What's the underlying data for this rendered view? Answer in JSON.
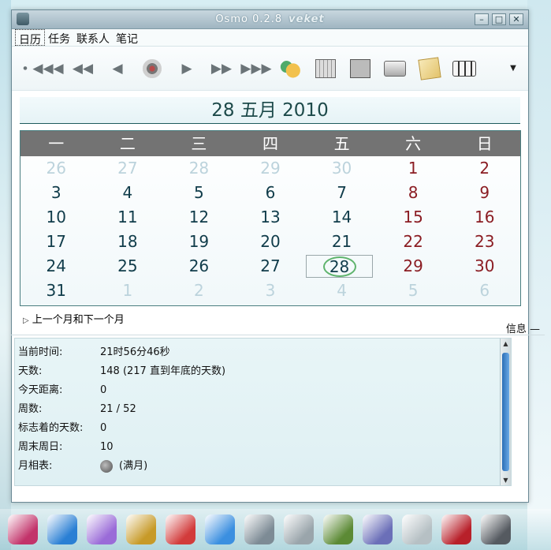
{
  "window": {
    "title": "Osmo 0.2.8",
    "subtitle": "veket",
    "controls": {
      "minimize": "–",
      "maximize": "□",
      "close": "✕"
    }
  },
  "menu": [
    "日历",
    "任务",
    "联系人",
    "笔记"
  ],
  "toolbar": {
    "buttons": [
      "prev-year-icon",
      "prev-month-icon",
      "prev-day-icon",
      "today-icon",
      "next-day-icon",
      "next-month-icon",
      "next-year-icon",
      "sync-icon",
      "calendar-grid-icon",
      "calculator-icon",
      "printer-icon",
      "edit-note-icon",
      "cards-icon",
      "menu-arrow-icon"
    ]
  },
  "date_header": "28 五月 2010",
  "weekdays": [
    "一",
    "二",
    "三",
    "四",
    "五",
    "六",
    "日"
  ],
  "days": [
    {
      "n": "26",
      "t": "other"
    },
    {
      "n": "27",
      "t": "other"
    },
    {
      "n": "28",
      "t": "other"
    },
    {
      "n": "29",
      "t": "other"
    },
    {
      "n": "30",
      "t": "other"
    },
    {
      "n": "1",
      "t": "weekend"
    },
    {
      "n": "2",
      "t": "weekend"
    },
    {
      "n": "3",
      "t": ""
    },
    {
      "n": "4",
      "t": ""
    },
    {
      "n": "5",
      "t": ""
    },
    {
      "n": "6",
      "t": ""
    },
    {
      "n": "7",
      "t": ""
    },
    {
      "n": "8",
      "t": "weekend"
    },
    {
      "n": "9",
      "t": "weekend"
    },
    {
      "n": "10",
      "t": ""
    },
    {
      "n": "11",
      "t": ""
    },
    {
      "n": "12",
      "t": ""
    },
    {
      "n": "13",
      "t": ""
    },
    {
      "n": "14",
      "t": ""
    },
    {
      "n": "15",
      "t": "weekend"
    },
    {
      "n": "16",
      "t": "weekend"
    },
    {
      "n": "17",
      "t": ""
    },
    {
      "n": "18",
      "t": ""
    },
    {
      "n": "19",
      "t": ""
    },
    {
      "n": "20",
      "t": ""
    },
    {
      "n": "21",
      "t": ""
    },
    {
      "n": "22",
      "t": "weekend"
    },
    {
      "n": "23",
      "t": "weekend"
    },
    {
      "n": "24",
      "t": ""
    },
    {
      "n": "25",
      "t": ""
    },
    {
      "n": "26",
      "t": ""
    },
    {
      "n": "27",
      "t": ""
    },
    {
      "n": "28",
      "t": "selected"
    },
    {
      "n": "29",
      "t": "weekend"
    },
    {
      "n": "30",
      "t": "weekend"
    },
    {
      "n": "31",
      "t": ""
    },
    {
      "n": "1",
      "t": "other"
    },
    {
      "n": "2",
      "t": "other"
    },
    {
      "n": "3",
      "t": "other"
    },
    {
      "n": "4",
      "t": "other"
    },
    {
      "n": "5",
      "t": "other"
    },
    {
      "n": "6",
      "t": "other"
    }
  ],
  "expander_label": "上一个月和下一个月",
  "info_label": "信息",
  "info": [
    {
      "k": "当前时间:",
      "v": "21时56分46秒"
    },
    {
      "k": "天数:",
      "v": "148 (217 直到年底的天数)"
    },
    {
      "k": "今天距离:",
      "v": "0"
    },
    {
      "k": "周数:",
      "v": "21 / 52"
    },
    {
      "k": "标志着的天数:",
      "v": "0"
    },
    {
      "k": "周末周日:",
      "v": "10"
    },
    {
      "k": "月相表:",
      "v": "(满月)"
    }
  ],
  "dock": [
    {
      "name": "flower-app-icon",
      "color": "#c2336a"
    },
    {
      "name": "globe-app-icon",
      "color": "#2a7fd4"
    },
    {
      "name": "paint-app-icon",
      "color": "#9a6bd8"
    },
    {
      "name": "gramophone-app-icon",
      "color": "#c79a28"
    },
    {
      "name": "network-app-icon",
      "color": "#d23b3b"
    },
    {
      "name": "chat-app-icon",
      "color": "#3b8fe0"
    },
    {
      "name": "document-app-icon",
      "color": "#7d8b95"
    },
    {
      "name": "notes-app-icon",
      "color": "#9aa5ab"
    },
    {
      "name": "image-app-icon",
      "color": "#5c8a35"
    },
    {
      "name": "disk-app-icon",
      "color": "#6b6fb8"
    },
    {
      "name": "calendar-app-icon",
      "color": "#b6c0c4"
    },
    {
      "name": "help-app-icon",
      "color": "#b8202a"
    },
    {
      "name": "webcam-app-icon",
      "color": "#555a60"
    }
  ]
}
